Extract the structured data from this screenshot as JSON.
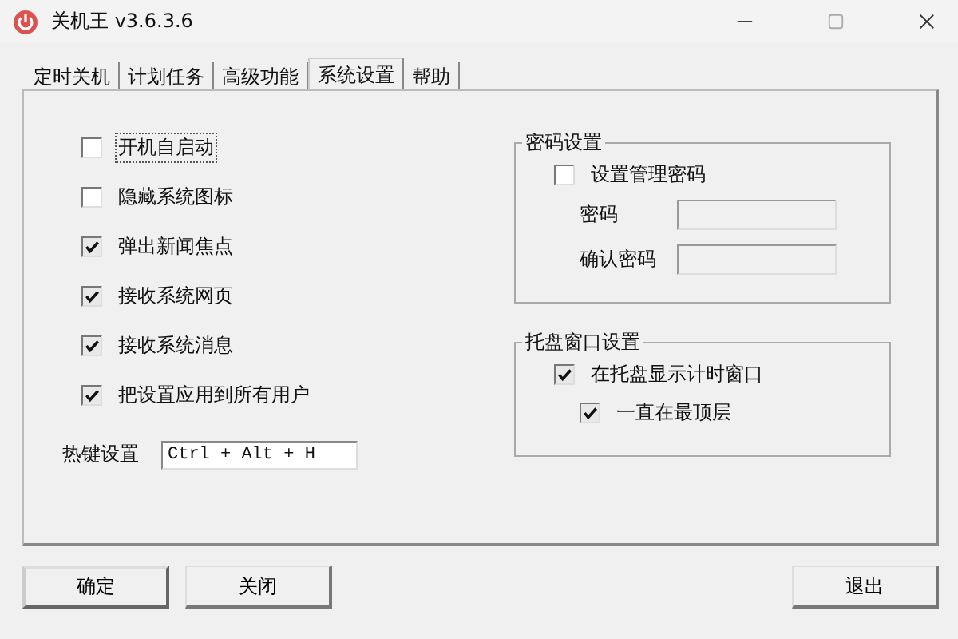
{
  "window": {
    "title": "关机王 v3.6.3.6"
  },
  "tabs": [
    {
      "label": "定时关机",
      "selected": false
    },
    {
      "label": "计划任务",
      "selected": false
    },
    {
      "label": "高级功能",
      "selected": false
    },
    {
      "label": "系统设置",
      "selected": true
    },
    {
      "label": "帮助",
      "selected": false
    }
  ],
  "options": [
    {
      "label": "开机自启动",
      "checked": false,
      "focused": true
    },
    {
      "label": "隐藏系统图标",
      "checked": false,
      "focused": false
    },
    {
      "label": "弹出新闻焦点",
      "checked": true,
      "focused": false
    },
    {
      "label": "接收系统网页",
      "checked": true,
      "focused": false
    },
    {
      "label": "接收系统消息",
      "checked": true,
      "focused": false
    },
    {
      "label": "把设置应用到所有用户",
      "checked": true,
      "focused": false
    }
  ],
  "hotkey": {
    "label": "热键设置",
    "value": "Ctrl + Alt + H"
  },
  "password_group": {
    "title": "密码设置",
    "option": {
      "label": "设置管理密码",
      "checked": false
    },
    "fields": [
      {
        "label": "密码"
      },
      {
        "label": "确认密码"
      }
    ]
  },
  "tray_group": {
    "title": "托盘窗口设置",
    "option": {
      "label": "在托盘显示计时窗口",
      "checked": true,
      "children": [
        {
          "label": "一直在最顶层",
          "checked": true
        }
      ]
    }
  },
  "buttons": [
    {
      "label": "确定",
      "default": true
    },
    {
      "label": "关闭",
      "default": false
    },
    {
      "label": "退出",
      "default": false
    }
  ]
}
